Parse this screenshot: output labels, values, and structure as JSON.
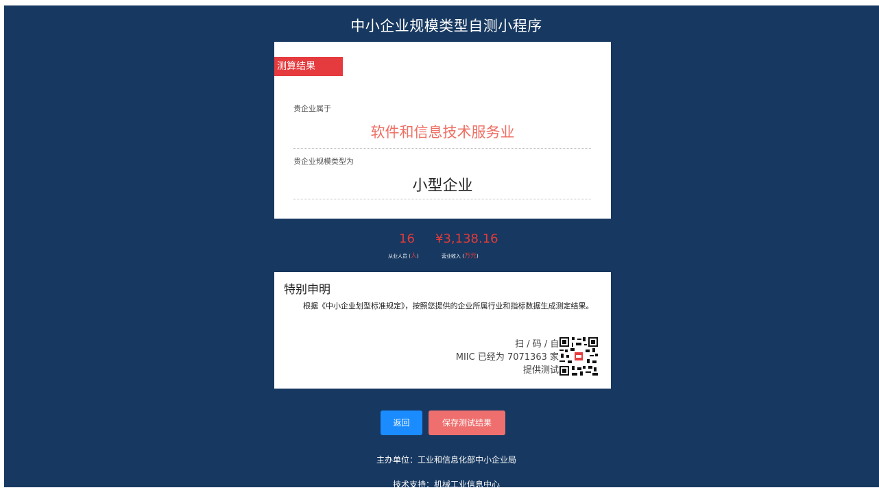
{
  "header": {
    "title": "中小企业规模类型自测小程序"
  },
  "result": {
    "tag": "测算结果",
    "industry_label": "贵企业属于",
    "industry": "软件和信息技术服务业",
    "size_label": "贵企业规模类型为",
    "size": "小型企业"
  },
  "stats": {
    "employees": {
      "value": "16",
      "label": "从业人员 (",
      "unit": "人",
      "close": ")"
    },
    "revenue": {
      "value": "¥3,138.16",
      "label": "营业收入 (",
      "unit": "万元",
      "close": ")"
    }
  },
  "notice": {
    "title": "特别申明",
    "body": "根据《中小企业划型标准规定》，按照您提供的企业所属行业和指标数据生成测定结果。",
    "qr_line1": "扫 / 码 / 自 / 测",
    "qr_line2": "MIIC 已经为 7071363 家企业",
    "qr_line3": "提供测试服务"
  },
  "actions": {
    "back_label": "返回",
    "save_label": "保存测试结果"
  },
  "footer": {
    "sponsor": "主办单位：工业和信息化部中小企业局",
    "support": "技术支持：机械工业信息中心"
  },
  "colors": {
    "background": "#173860",
    "accent_red": "#e63b3e",
    "button_blue": "#1a8cff",
    "button_save": "#ee6f6e"
  }
}
